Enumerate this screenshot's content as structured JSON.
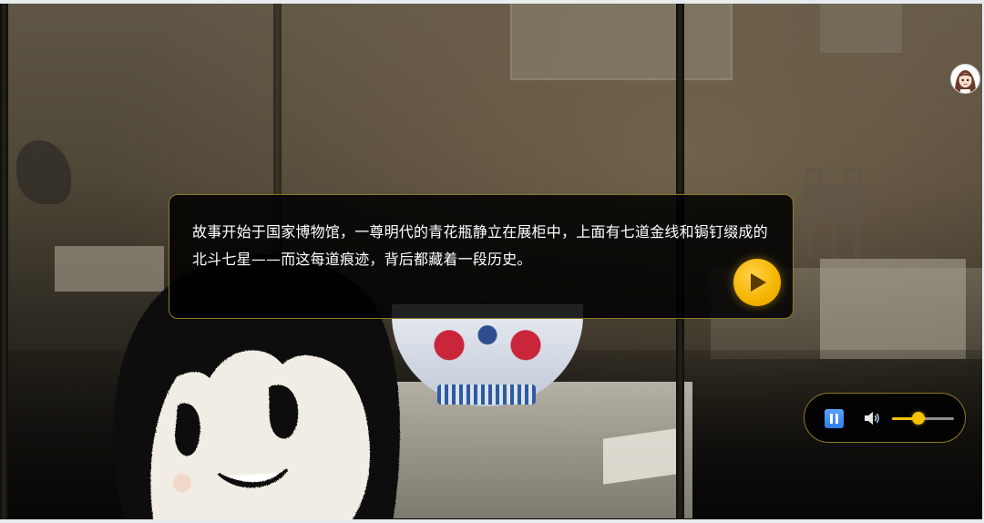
{
  "scene": {
    "background": "museum-gallery-photo",
    "character": "sketch-girl"
  },
  "dialog": {
    "text": "故事开始于国家博物馆，一尊明代的青花瓶静立在展柜中，上面有七道金线和锔钉缀成的北斗七星——而这每道痕迹，背后都藏着一段历史。",
    "next_icon": "play-icon",
    "accent_color": "#F4B400",
    "border_color": "#8D7A23"
  },
  "audio_controls": {
    "pause_icon": "pause-icon",
    "volume_icon": "speaker-icon",
    "volume_level": 0.42
  },
  "user": {
    "avatar_icon": "user-avatar-icon"
  }
}
